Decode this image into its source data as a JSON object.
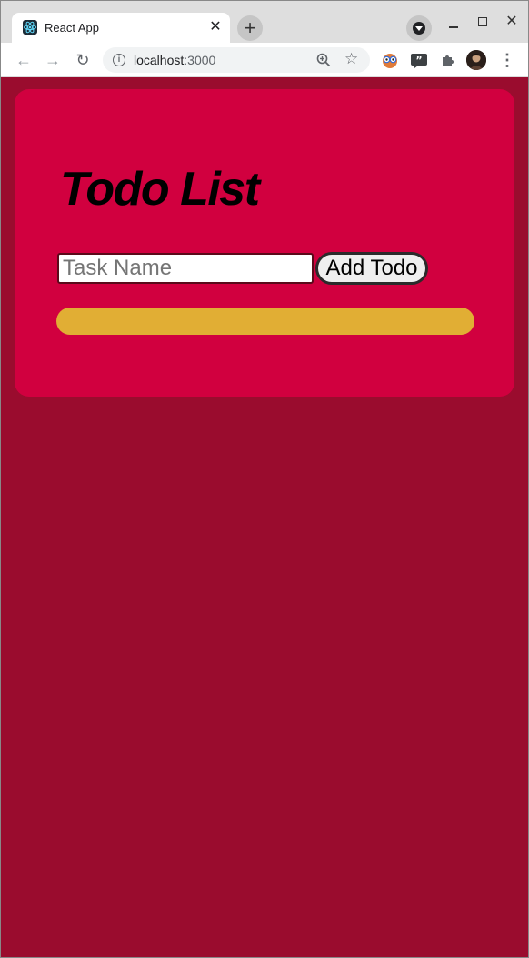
{
  "browser": {
    "tab": {
      "title": "React App",
      "close_symbol": "✕"
    },
    "new_tab_symbol": "+",
    "window_controls": {
      "close_symbol": "✕"
    },
    "nav": {
      "back_symbol": "←",
      "forward_symbol": "→",
      "reload_symbol": "↻"
    },
    "address": {
      "host": "localhost",
      "port": ":3000"
    },
    "star_symbol": "☆",
    "menu_symbol": "⋮"
  },
  "app": {
    "title": "Todo List",
    "input": {
      "placeholder": "Task Name",
      "value": ""
    },
    "add_button_label": "Add Todo"
  },
  "colors": {
    "page_background": "#9a0c2e",
    "card_background": "#d1003f",
    "todo_bar": "#e1ae34"
  }
}
